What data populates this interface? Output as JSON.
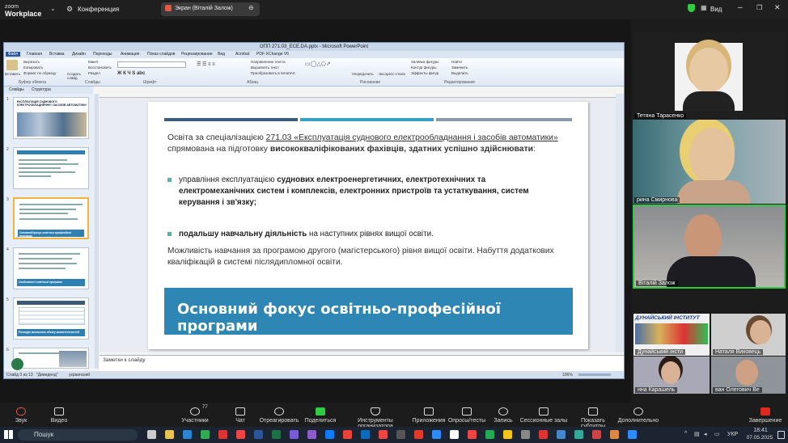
{
  "zoom": {
    "logo_line1": "zoom",
    "logo_line2": "Workplace",
    "meeting_title": "Конференция",
    "share_label": "Экран (Віталій Залож)",
    "view_label": "Вид"
  },
  "ppt": {
    "window_title": "ОПП 271.03_ЕСЕ.DA.pptx - Microsoft PowerPoint",
    "tabs": [
      "Файл",
      "Главная",
      "Вставка",
      "Дизайн",
      "Переходы",
      "Анимация",
      "Показ слайдов",
      "Рецензирование",
      "Вид",
      "Acrobat",
      "PDF-XChange V6"
    ],
    "ribbon_groups": [
      "Буфер обмена",
      "Слайды",
      "Шрифт",
      "Абзац",
      "Рисование",
      "Редактирование"
    ],
    "ribbon_items": [
      "Вырезать",
      "Копировать",
      "Формат по образцу",
      "Вставить",
      "Макет",
      "Восстановить",
      "Раздел",
      "Создать слайд",
      "Направление текста",
      "Выровнять текст",
      "Преобразовать в SmartArt",
      "Упорядочить",
      "Экспресс-стили",
      "Заливка фигуры",
      "Контур фигуры",
      "Эффекты фигур",
      "Найти",
      "Заменить",
      "Выделить"
    ],
    "panel_tabs": [
      "Слайды",
      "Структура"
    ],
    "thumb_numbers": [
      "1",
      "2",
      "3",
      "4",
      "5",
      "6"
    ],
    "thumb_texts": [
      "ЕКСПЛУАТАЦІЯ СУДНОВОГО ЕЛЕКТРООБЛАДНЕННЯ І ЗАСОБІВ АВТОМАТИКИ",
      "Основний фокус освітньо-професійної програми",
      "Особливості освітньої програми",
      "Розподіл загального обсягу компетентностей"
    ],
    "notes_placeholder": "Заметки к слайду",
    "status_slide": "Слайд 3 из 13",
    "status_theme": "\"Дивиденд\"",
    "status_lang": "украинский",
    "status_zoom": "106%"
  },
  "slide": {
    "intro_prefix": "Освіта за спеціалізацією ",
    "intro_underlined": "271.03 «Експлуатація суднового електрообладнання і засобів автоматики»",
    "intro_mid": " спрямована на підготовку ",
    "intro_bold": "висококваліфікованих фахівців, здатних успішно здійснювати",
    "intro_end": ":",
    "bullet1_a": "управління експлуатацією ",
    "bullet1_b": "суднових електроенергетичних, електротехнічних та електромеханічних систем і комплексів, електронних пристроїв та устаткування, систем керування і зв'язку;",
    "bullet2_a": "подальшу навчальну діяльність",
    "bullet2_b": " на наступних рівнях вищої освіти.",
    "para": "Можливість навчання за програмою другого (магістерського) рівня вищої освіти. Набуття додаткових кваліфікацій в системі післядипломної освіти.",
    "banner": "Основний фокус освітньо-професійної програми"
  },
  "participants": [
    {
      "name": "Тетяна Тарасенко"
    },
    {
      "name": "рина Смирнова"
    },
    {
      "name": "Віталій Залож"
    },
    {
      "name": "Дунайський інсти"
    },
    {
      "name": "Наталя Виковець"
    },
    {
      "name": "нна Карашель"
    },
    {
      "name": "ван Олегович Ве"
    }
  ],
  "danube_logo": "ДУНАЙСЬКИЙ ІНСТИТУТ",
  "controls": [
    {
      "label": "Звук",
      "icon": "mic-muted-icon"
    },
    {
      "label": "Видео",
      "icon": "camera-icon"
    },
    {
      "label": "Участники",
      "icon": "participants-icon",
      "count": "77"
    },
    {
      "label": "Чат",
      "icon": "chat-icon"
    },
    {
      "label": "Отреагировать",
      "icon": "reaction-icon"
    },
    {
      "label": "Поделиться",
      "icon": "share-icon"
    },
    {
      "label": "Инструменты организатора",
      "icon": "shield-icon"
    },
    {
      "label": "Приложения",
      "icon": "apps-icon"
    },
    {
      "label": "Опросы/тесты",
      "icon": "polls-icon"
    },
    {
      "label": "Запись",
      "icon": "record-icon"
    },
    {
      "label": "Сессионные залы",
      "icon": "rooms-icon"
    },
    {
      "label": "Показать субтитры",
      "icon": "cc-icon"
    },
    {
      "label": "Дополнительно",
      "icon": "more-icon"
    },
    {
      "label": "Завершение",
      "icon": "end-icon"
    }
  ],
  "taskbar": {
    "search": "Пошук",
    "lang": "УКР",
    "time": "18:41",
    "date": "07.05.2025"
  },
  "colors": {
    "banner": "#2e86b4",
    "bullet": "#4fb4a8",
    "stripe1": "#3c5d7c",
    "stripe2": "#3aa0c8",
    "stripe3": "#8a9aa8",
    "accent_green": "#2ecc40"
  }
}
